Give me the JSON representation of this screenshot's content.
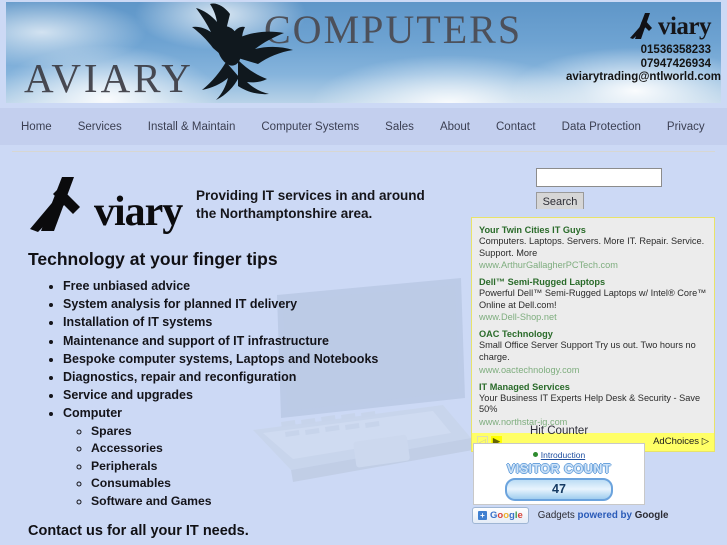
{
  "banner": {
    "left_word": "AVIARY",
    "top_word": "COMPUTERS",
    "brand_word": "viary",
    "phone1": "01536358233",
    "phone2": "07947426934",
    "email": "aviarytrading@ntlworld.com",
    "eagle_icon": "eagle-icon"
  },
  "nav": {
    "items": [
      {
        "label": "Home"
      },
      {
        "label": "Services"
      },
      {
        "label": "Install & Maintain"
      },
      {
        "label": "Computer Systems"
      },
      {
        "label": "Sales"
      },
      {
        "label": "About"
      },
      {
        "label": "Contact"
      },
      {
        "label": "Data Protection"
      },
      {
        "label": "Privacy"
      }
    ]
  },
  "main": {
    "brand_word": "viary",
    "tagline": "Providing IT services in and around the Northamptonshire area.",
    "headline": "Technology at your finger tips",
    "services": [
      "Free unbiased advice",
      "System analysis for planned IT delivery",
      "Installation of IT systems",
      "Maintenance and support of IT infrastructure",
      "Bespoke computer systems, Laptops and Notebooks",
      "Diagnostics, repair and reconfiguration",
      "Service and upgrades",
      "Computer"
    ],
    "computer_sub": [
      "Spares",
      "Accessories",
      "Peripherals",
      "Consumables",
      "Software and Games"
    ],
    "closing": "Contact us for all your IT needs."
  },
  "search": {
    "value": "",
    "placeholder": "",
    "button_label": "Search"
  },
  "ads": {
    "entries": [
      {
        "title": "Your Twin Cities IT Guys",
        "desc": "Computers. Laptops. Servers. More IT. Repair. Service. Support. More",
        "url": "www.ArthurGallagherPCTech.com"
      },
      {
        "title": "Dell™ Semi-Rugged Laptops",
        "desc": "Powerful Dell™ Semi-Rugged Laptops w/ Intel® Core™ Online at Dell.com!",
        "url": "www.Dell-Shop.net"
      },
      {
        "title": "OAC Technology",
        "desc": "Small Office Server Support Try us out. Two hours no charge.",
        "url": "www.oactechnology.com"
      },
      {
        "title": "IT Managed Services",
        "desc": "Your Business IT Experts Help Desk & Security - Save 50%",
        "url": "www.northstar-ig.com"
      }
    ],
    "prev_arrow": "◁",
    "next_arrow": "▶",
    "adchoices_label": "AdChoices",
    "adchoices_icon": "▷"
  },
  "counter": {
    "label": "Hit Counter",
    "intro_link": "Introduction",
    "title": "VISITOR COUNT",
    "value": "47",
    "google_word_parts": [
      "G",
      "o",
      "o",
      "g",
      "l",
      "e"
    ],
    "gadget_text_plain": "Gadgets ",
    "gadget_text_link": "powered by",
    "gadget_text_tail": " Google"
  },
  "colors": {
    "page_bg": "#ccd9f5",
    "nav_bg": "#c3cfee",
    "ad_bg": "#ececec",
    "ad_border": "#e8e36a",
    "adchoices_bg": "#ffff66",
    "ad_title": "#2a6b2a",
    "ad_url": "#7fae7f"
  }
}
